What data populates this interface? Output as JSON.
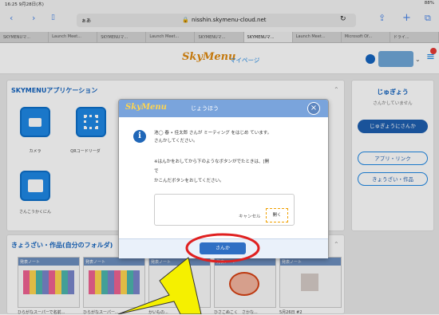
{
  "status": {
    "time": "16:25  9月28日(木)",
    "battery": "88%"
  },
  "browser": {
    "url": "nisshin.skymenu-cloud.net",
    "aa": "ぁあ",
    "tabs": [
      {
        "label": "SKYMENUマ..."
      },
      {
        "label": "Launch Meet..."
      },
      {
        "label": "SKYMENUマ..."
      },
      {
        "label": "Launch Meet..."
      },
      {
        "label": "SKYMENUマ..."
      },
      {
        "label": "SKYMENUマ..."
      },
      {
        "label": "Launch Meet..."
      },
      {
        "label": "Microsoft Of..."
      },
      {
        "label": "ドライ..."
      }
    ]
  },
  "header": {
    "logo": "SkyMenu",
    "mypage": "マイページ"
  },
  "apps": {
    "title": "SKYMENUアプリケーション",
    "items": [
      {
        "label": "カメラ"
      },
      {
        "label": "QRコードリーダ"
      },
      {
        "label": "さんこうかくにん"
      }
    ]
  },
  "side": {
    "class_title": "じゅぎょう",
    "class_status": "さんかしていません",
    "join_class": "じゅぎょうにさんか",
    "app_link": "アプリ・リンク",
    "materials": "きょうざい・作品"
  },
  "works": {
    "title": "きょうざい・作品(自分のフォルダ)",
    "items": [
      {
        "tag": "発表ノート",
        "caption": "ひらがなスーパーで名前..."
      },
      {
        "tag": "発表ノート",
        "caption": "ひらがなスーパー..."
      },
      {
        "tag": "発表ノート",
        "caption": "かいもの..."
      },
      {
        "tag": "発表ノート",
        "caption": "ひさこぬこく　さかな..."
      },
      {
        "tag": "発表ノート",
        "caption": "5月26日 #2"
      }
    ]
  },
  "modal": {
    "logo": "SkyMenu",
    "title": "じょうほう",
    "line1": "池◯ 春 • 佳太郎 さんが ミーティング をはじめ ています。",
    "line2": "さんかしてください。",
    "line3": "※はんかをおしてから下のようなボタンがでたときは、[開",
    "line4": "で",
    "line5": "かこんだボタンをおしてください。",
    "cancel": "キャンセル",
    "open": "開く",
    "join": "さんか"
  },
  "colors": {
    "accent": "#1e88e5",
    "annotation": "#e02020",
    "arrow": "#f5f000"
  }
}
